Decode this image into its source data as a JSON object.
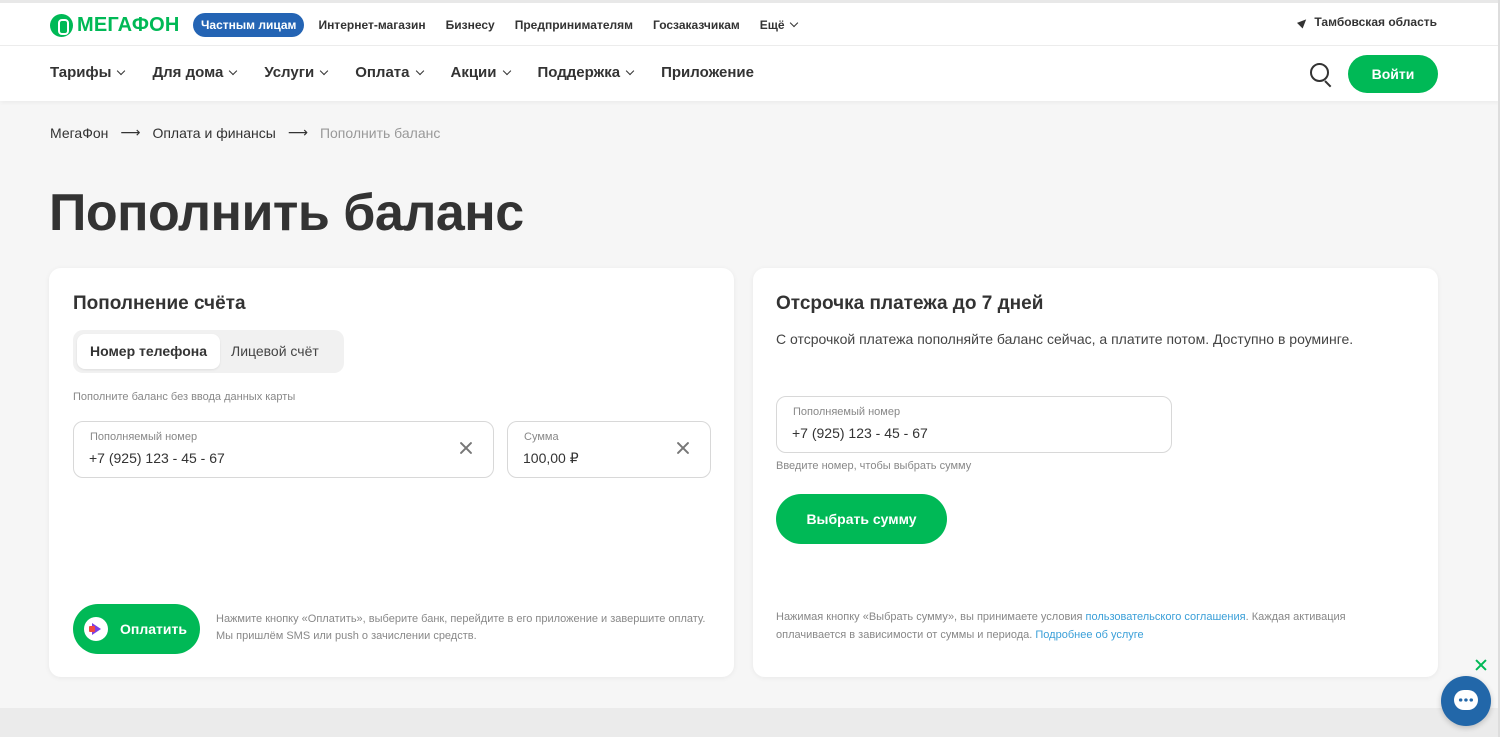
{
  "brand": {
    "name": "МегаФон",
    "logo_text": "МЕГАФОН",
    "accent": "#00b956",
    "blue": "#2464b4"
  },
  "topbar": {
    "links": [
      "Частным лицам",
      "Интернет-магазин",
      "Бизнесу",
      "Предпринимателям",
      "Госзаказчикам",
      "Ещё"
    ],
    "region": "Тамбовская область"
  },
  "nav": {
    "items": [
      "Тарифы",
      "Для дома",
      "Услуги",
      "Оплата",
      "Акции",
      "Поддержка",
      "Приложение"
    ],
    "login": "Войти"
  },
  "breadcrumb": [
    "МегаФон",
    "Оплата и финансы",
    "Пополнить баланс"
  ],
  "page_title": "Пополнить баланс",
  "topup": {
    "heading": "Пополнение счёта",
    "tabs": [
      "Номер телефона",
      "Лицевой счёт"
    ],
    "hint": "Пополните баланс без ввода данных карты",
    "phone_label": "Пополняемый номер",
    "phone_value": "+7 (925) 123 - 45 - 67",
    "amount_label": "Сумма",
    "amount_value": "100,00 ₽",
    "pay_button": "Оплатить",
    "pay_note": "Нажмите кнопку «Оплатить», выберите банк, перейдите в его приложение и завершите оплату. Мы пришлём SMS или push о зачислении средств."
  },
  "deferred": {
    "heading": "Отсрочка платежа до 7 дней",
    "description": "С отсрочкой платежа пополняйте баланс сейчас, а платите потом. Доступно в роуминге.",
    "phone_label": "Пополняемый номер",
    "phone_value": "+7 (925) 123 - 45 - 67",
    "phone_hint": "Введите номер, чтобы выбрать сумму",
    "choose_button": "Выбрать сумму",
    "terms_prefix": "Нажимая кнопку «Выбрать сумму», вы принимаете условия",
    "terms_link": "пользовательского соглашения",
    "terms_middle": ". Каждая активация оплачивается в зависимости от суммы и периода.",
    "more_link": "Подробнее об услуге"
  }
}
